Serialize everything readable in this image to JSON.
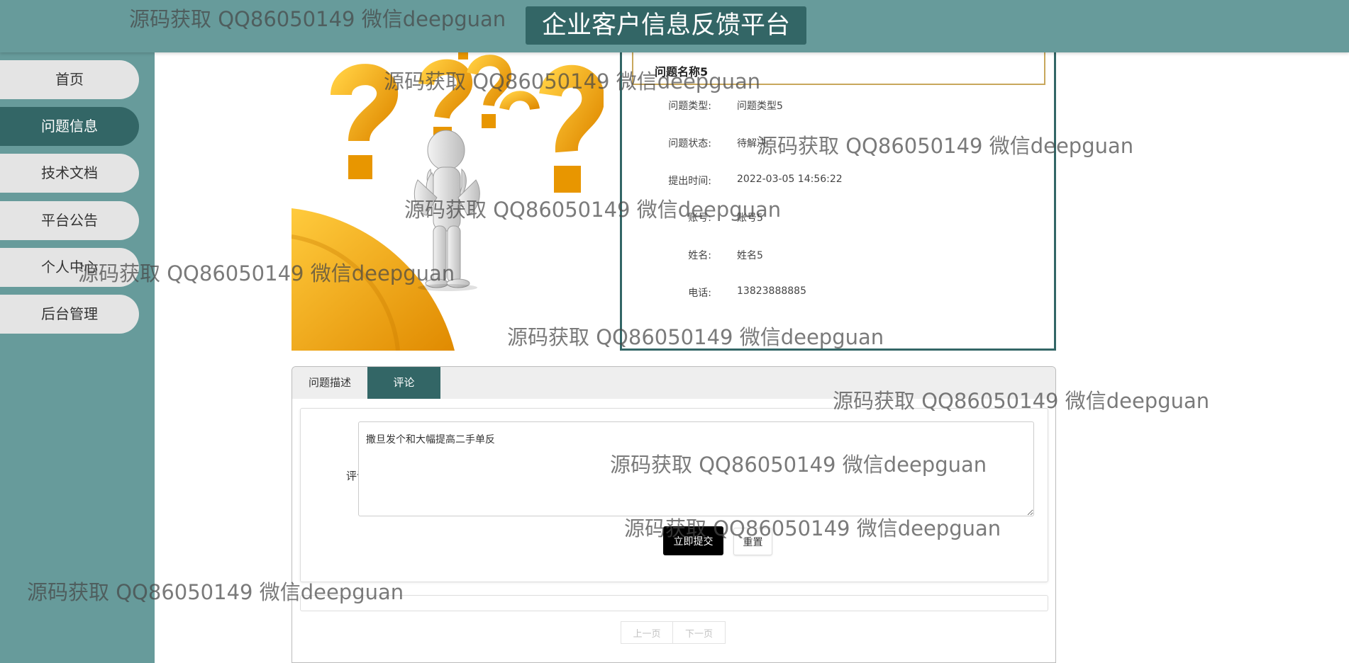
{
  "header": {
    "title": "企业客户信息反馈平台"
  },
  "sidebar": {
    "items": [
      {
        "label": "首页",
        "active": false
      },
      {
        "label": "问题信息",
        "active": true
      },
      {
        "label": "技术文档",
        "active": false
      },
      {
        "label": "平台公告",
        "active": false
      },
      {
        "label": "个人中心",
        "active": false
      },
      {
        "label": "后台管理",
        "active": false
      }
    ]
  },
  "detail": {
    "name": "问题名称5",
    "rows": [
      {
        "label": "问题类型:",
        "value": "问题类型5"
      },
      {
        "label": "问题状态:",
        "value": "待解决"
      },
      {
        "label": "提出时间:",
        "value": "2022-03-05 14:56:22"
      },
      {
        "label": "账号:",
        "value": "账号5"
      },
      {
        "label": "姓名:",
        "value": "姓名5"
      },
      {
        "label": "电话:",
        "value": "13823888885"
      }
    ]
  },
  "tabs": [
    {
      "label": "问题描述",
      "active": false
    },
    {
      "label": "评论",
      "active": true
    }
  ],
  "comment_form": {
    "label": "评论",
    "value": "撒旦发个和大幅提高二手单反",
    "submit_label": "立即提交",
    "reset_label": "重置"
  },
  "pager": {
    "prev_label": "上一页",
    "next_label": "下一页"
  },
  "watermark": "源码获取 QQ86050149 微信deepguan",
  "colors": {
    "primary": "#336666",
    "header": "#679b9b",
    "accent_border": "#c8a75c",
    "question_orange": "#f0a312"
  }
}
